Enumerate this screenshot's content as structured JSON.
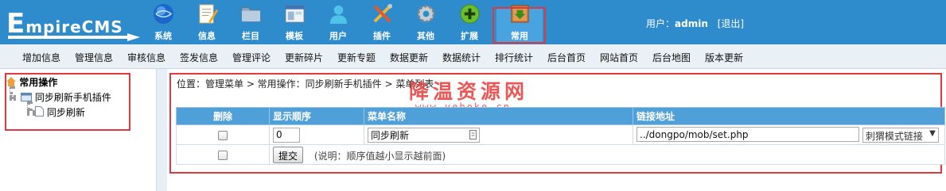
{
  "header": {
    "logo_e": "E",
    "logo_rest": "mpireCMS",
    "nav": [
      {
        "label": "系统",
        "icon": "globe-icon"
      },
      {
        "label": "信息",
        "icon": "document-edit-icon"
      },
      {
        "label": "栏目",
        "icon": "folder-icon"
      },
      {
        "label": "模板",
        "icon": "window-template-icon"
      },
      {
        "label": "用户",
        "icon": "user-icon"
      },
      {
        "label": "插件",
        "icon": "tools-icon"
      },
      {
        "label": "其他",
        "icon": "gear-icon"
      },
      {
        "label": "扩展",
        "icon": "plus-circle-icon"
      },
      {
        "label": "常用",
        "icon": "book-download-icon"
      }
    ],
    "user_prefix": "用户：",
    "user_name": "admin",
    "logout": "[退出]"
  },
  "toolbar": [
    "增加信息",
    "管理信息",
    "审核信息",
    "签发信息",
    "管理评论",
    "更新碎片",
    "更新专题",
    "数据更新",
    "数据统计",
    "排行统计",
    "后台首页",
    "网站首页",
    "后台地图",
    "版本更新"
  ],
  "tree": {
    "root": "常用操作",
    "level1": "同步刷新手机插件",
    "level2": "同步刷新"
  },
  "main": {
    "breadcrumb": "位置：管理菜单 > 常用操作：同步刷新手机插件 > 菜单列表",
    "watermark": "降温资源网",
    "watermark_url": "www.yeboke.cn",
    "columns": [
      "删除",
      "显示顺序",
      "菜单名称",
      "链接地址"
    ],
    "row": {
      "order": "0",
      "name": "同步刷新",
      "link": "../dongpo/mob/set.php",
      "mode": "刺猬模式链接"
    },
    "submit": "提交",
    "note": "(说明：顺序值越小显示越前面)"
  },
  "colors": {
    "header_bg": "#2f8ccc",
    "table_header": "#4f9fd8",
    "highlight_red": "#e0383e"
  }
}
